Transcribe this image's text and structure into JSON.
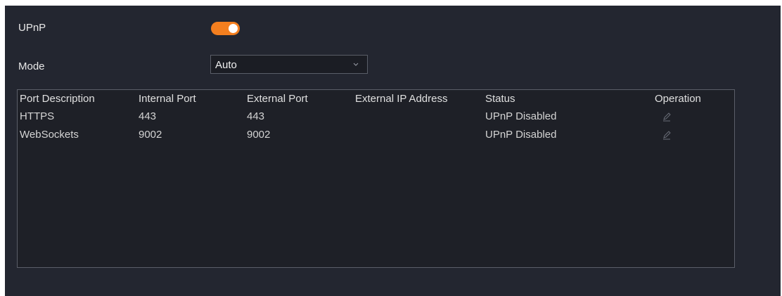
{
  "upnp": {
    "label": "UPnP",
    "enabled": true,
    "toggle_color": "#f47f1f"
  },
  "mode": {
    "label": "Mode",
    "value": "Auto"
  },
  "table": {
    "headers": [
      "Port Description",
      "Internal Port",
      "External Port",
      "External IP Address",
      "Status",
      "Operation"
    ],
    "rows": [
      {
        "description": "HTTPS",
        "internal": "443",
        "external": "443",
        "external_ip": "",
        "status": "UPnP Disabled",
        "operation_icon": "edit-icon"
      },
      {
        "description": "WebSockets",
        "internal": "9002",
        "external": "9002",
        "external_ip": "",
        "status": "UPnP Disabled",
        "operation_icon": "edit-icon"
      }
    ]
  },
  "colors": {
    "panel_bg": "#232630",
    "accent": "#f47f1f"
  }
}
